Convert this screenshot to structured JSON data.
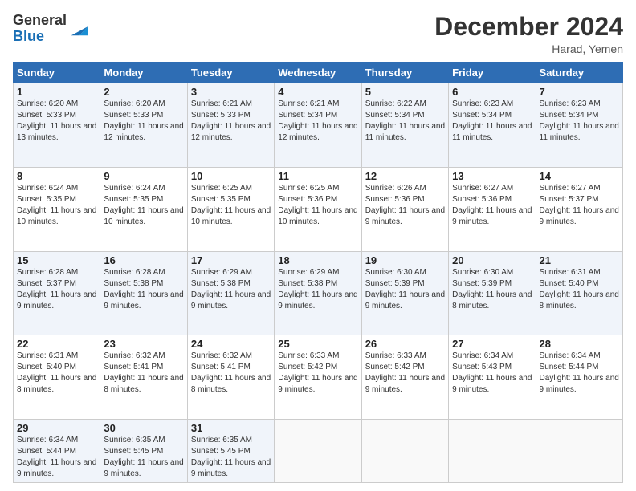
{
  "logo": {
    "line1": "General",
    "line2": "Blue"
  },
  "header": {
    "month_year": "December 2024",
    "location": "Harad, Yemen"
  },
  "days_of_week": [
    "Sunday",
    "Monday",
    "Tuesday",
    "Wednesday",
    "Thursday",
    "Friday",
    "Saturday"
  ],
  "weeks": [
    [
      {
        "day": "1",
        "sunrise": "6:20 AM",
        "sunset": "5:33 PM",
        "daylight": "11 hours and 13 minutes."
      },
      {
        "day": "2",
        "sunrise": "6:20 AM",
        "sunset": "5:33 PM",
        "daylight": "11 hours and 12 minutes."
      },
      {
        "day": "3",
        "sunrise": "6:21 AM",
        "sunset": "5:33 PM",
        "daylight": "11 hours and 12 minutes."
      },
      {
        "day": "4",
        "sunrise": "6:21 AM",
        "sunset": "5:34 PM",
        "daylight": "11 hours and 12 minutes."
      },
      {
        "day": "5",
        "sunrise": "6:22 AM",
        "sunset": "5:34 PM",
        "daylight": "11 hours and 11 minutes."
      },
      {
        "day": "6",
        "sunrise": "6:23 AM",
        "sunset": "5:34 PM",
        "daylight": "11 hours and 11 minutes."
      },
      {
        "day": "7",
        "sunrise": "6:23 AM",
        "sunset": "5:34 PM",
        "daylight": "11 hours and 11 minutes."
      }
    ],
    [
      {
        "day": "8",
        "sunrise": "6:24 AM",
        "sunset": "5:35 PM",
        "daylight": "11 hours and 10 minutes."
      },
      {
        "day": "9",
        "sunrise": "6:24 AM",
        "sunset": "5:35 PM",
        "daylight": "11 hours and 10 minutes."
      },
      {
        "day": "10",
        "sunrise": "6:25 AM",
        "sunset": "5:35 PM",
        "daylight": "11 hours and 10 minutes."
      },
      {
        "day": "11",
        "sunrise": "6:25 AM",
        "sunset": "5:36 PM",
        "daylight": "11 hours and 10 minutes."
      },
      {
        "day": "12",
        "sunrise": "6:26 AM",
        "sunset": "5:36 PM",
        "daylight": "11 hours and 9 minutes."
      },
      {
        "day": "13",
        "sunrise": "6:27 AM",
        "sunset": "5:36 PM",
        "daylight": "11 hours and 9 minutes."
      },
      {
        "day": "14",
        "sunrise": "6:27 AM",
        "sunset": "5:37 PM",
        "daylight": "11 hours and 9 minutes."
      }
    ],
    [
      {
        "day": "15",
        "sunrise": "6:28 AM",
        "sunset": "5:37 PM",
        "daylight": "11 hours and 9 minutes."
      },
      {
        "day": "16",
        "sunrise": "6:28 AM",
        "sunset": "5:38 PM",
        "daylight": "11 hours and 9 minutes."
      },
      {
        "day": "17",
        "sunrise": "6:29 AM",
        "sunset": "5:38 PM",
        "daylight": "11 hours and 9 minutes."
      },
      {
        "day": "18",
        "sunrise": "6:29 AM",
        "sunset": "5:38 PM",
        "daylight": "11 hours and 9 minutes."
      },
      {
        "day": "19",
        "sunrise": "6:30 AM",
        "sunset": "5:39 PM",
        "daylight": "11 hours and 9 minutes."
      },
      {
        "day": "20",
        "sunrise": "6:30 AM",
        "sunset": "5:39 PM",
        "daylight": "11 hours and 8 minutes."
      },
      {
        "day": "21",
        "sunrise": "6:31 AM",
        "sunset": "5:40 PM",
        "daylight": "11 hours and 8 minutes."
      }
    ],
    [
      {
        "day": "22",
        "sunrise": "6:31 AM",
        "sunset": "5:40 PM",
        "daylight": "11 hours and 8 minutes."
      },
      {
        "day": "23",
        "sunrise": "6:32 AM",
        "sunset": "5:41 PM",
        "daylight": "11 hours and 8 minutes."
      },
      {
        "day": "24",
        "sunrise": "6:32 AM",
        "sunset": "5:41 PM",
        "daylight": "11 hours and 8 minutes."
      },
      {
        "day": "25",
        "sunrise": "6:33 AM",
        "sunset": "5:42 PM",
        "daylight": "11 hours and 9 minutes."
      },
      {
        "day": "26",
        "sunrise": "6:33 AM",
        "sunset": "5:42 PM",
        "daylight": "11 hours and 9 minutes."
      },
      {
        "day": "27",
        "sunrise": "6:34 AM",
        "sunset": "5:43 PM",
        "daylight": "11 hours and 9 minutes."
      },
      {
        "day": "28",
        "sunrise": "6:34 AM",
        "sunset": "5:44 PM",
        "daylight": "11 hours and 9 minutes."
      }
    ],
    [
      {
        "day": "29",
        "sunrise": "6:34 AM",
        "sunset": "5:44 PM",
        "daylight": "11 hours and 9 minutes."
      },
      {
        "day": "30",
        "sunrise": "6:35 AM",
        "sunset": "5:45 PM",
        "daylight": "11 hours and 9 minutes."
      },
      {
        "day": "31",
        "sunrise": "6:35 AM",
        "sunset": "5:45 PM",
        "daylight": "11 hours and 9 minutes."
      },
      null,
      null,
      null,
      null
    ]
  ]
}
